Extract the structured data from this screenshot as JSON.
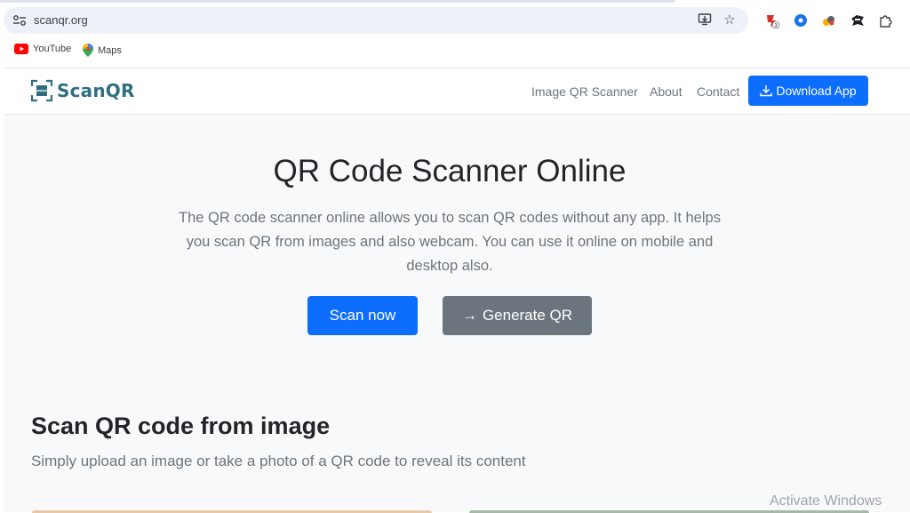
{
  "browser": {
    "url": "scanqr.org",
    "extensions": [
      {
        "name": "extension-badge-icon",
        "badge": "3"
      }
    ],
    "bookmarks": [
      {
        "label": "YouTube",
        "icon": "youtube-icon"
      },
      {
        "label": "Maps",
        "icon": "maps-pin-icon"
      }
    ]
  },
  "navbar": {
    "brand": "ScanQR",
    "links": [
      "Image QR Scanner",
      "About",
      "Contact"
    ],
    "download_label": "Download App"
  },
  "hero": {
    "title": "QR Code Scanner Online",
    "description": "The QR code scanner online allows you to scan QR codes without any app. It helps you scan QR from images and also webcam. You can use it online on mobile and desktop also.",
    "scan_label": "Scan now",
    "generate_label": "Generate QR"
  },
  "section": {
    "title": "Scan QR code from image",
    "subtitle": "Simply upload an image or take a photo of a QR code to reveal its content"
  },
  "watermark": "Activate Windows",
  "colors": {
    "primary": "#0d6efd",
    "secondary": "#6c757d",
    "brand": "#2f6f7e"
  }
}
